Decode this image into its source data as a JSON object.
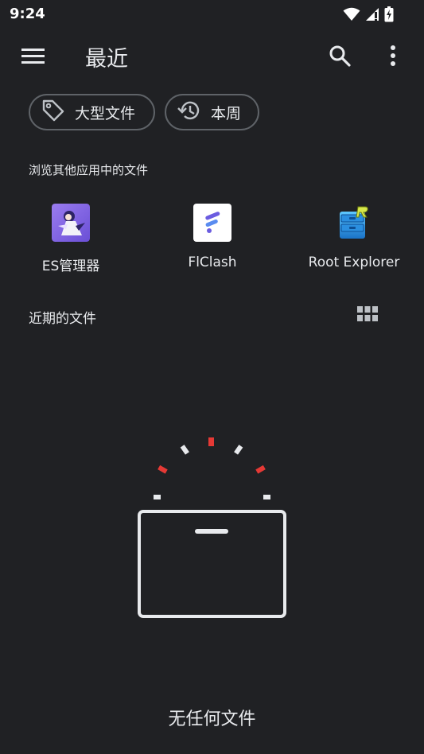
{
  "status_bar": {
    "time": "9:24",
    "icons": [
      "wifi-icon",
      "signal-icon",
      "battery-charging-icon"
    ]
  },
  "toolbar": {
    "title": "最近",
    "menu_icon": "menu-icon",
    "search_icon": "search-icon",
    "more_icon": "more-vert-icon"
  },
  "chips": [
    {
      "label": "大型文件",
      "icon": "tag-icon"
    },
    {
      "label": "本周",
      "icon": "history-icon"
    }
  ],
  "browse_section": {
    "label": "浏览其他应用中的文件",
    "apps": [
      {
        "name": "ES管理器"
      },
      {
        "name": "FlClash"
      },
      {
        "name": "Root Explorer"
      }
    ]
  },
  "recent_section": {
    "label": "近期的文件",
    "view_toggle_icon": "grid-view-icon"
  },
  "empty_state": {
    "text": "无任何文件",
    "icon": "empty-box-icon",
    "accent_color": "#e53935"
  }
}
